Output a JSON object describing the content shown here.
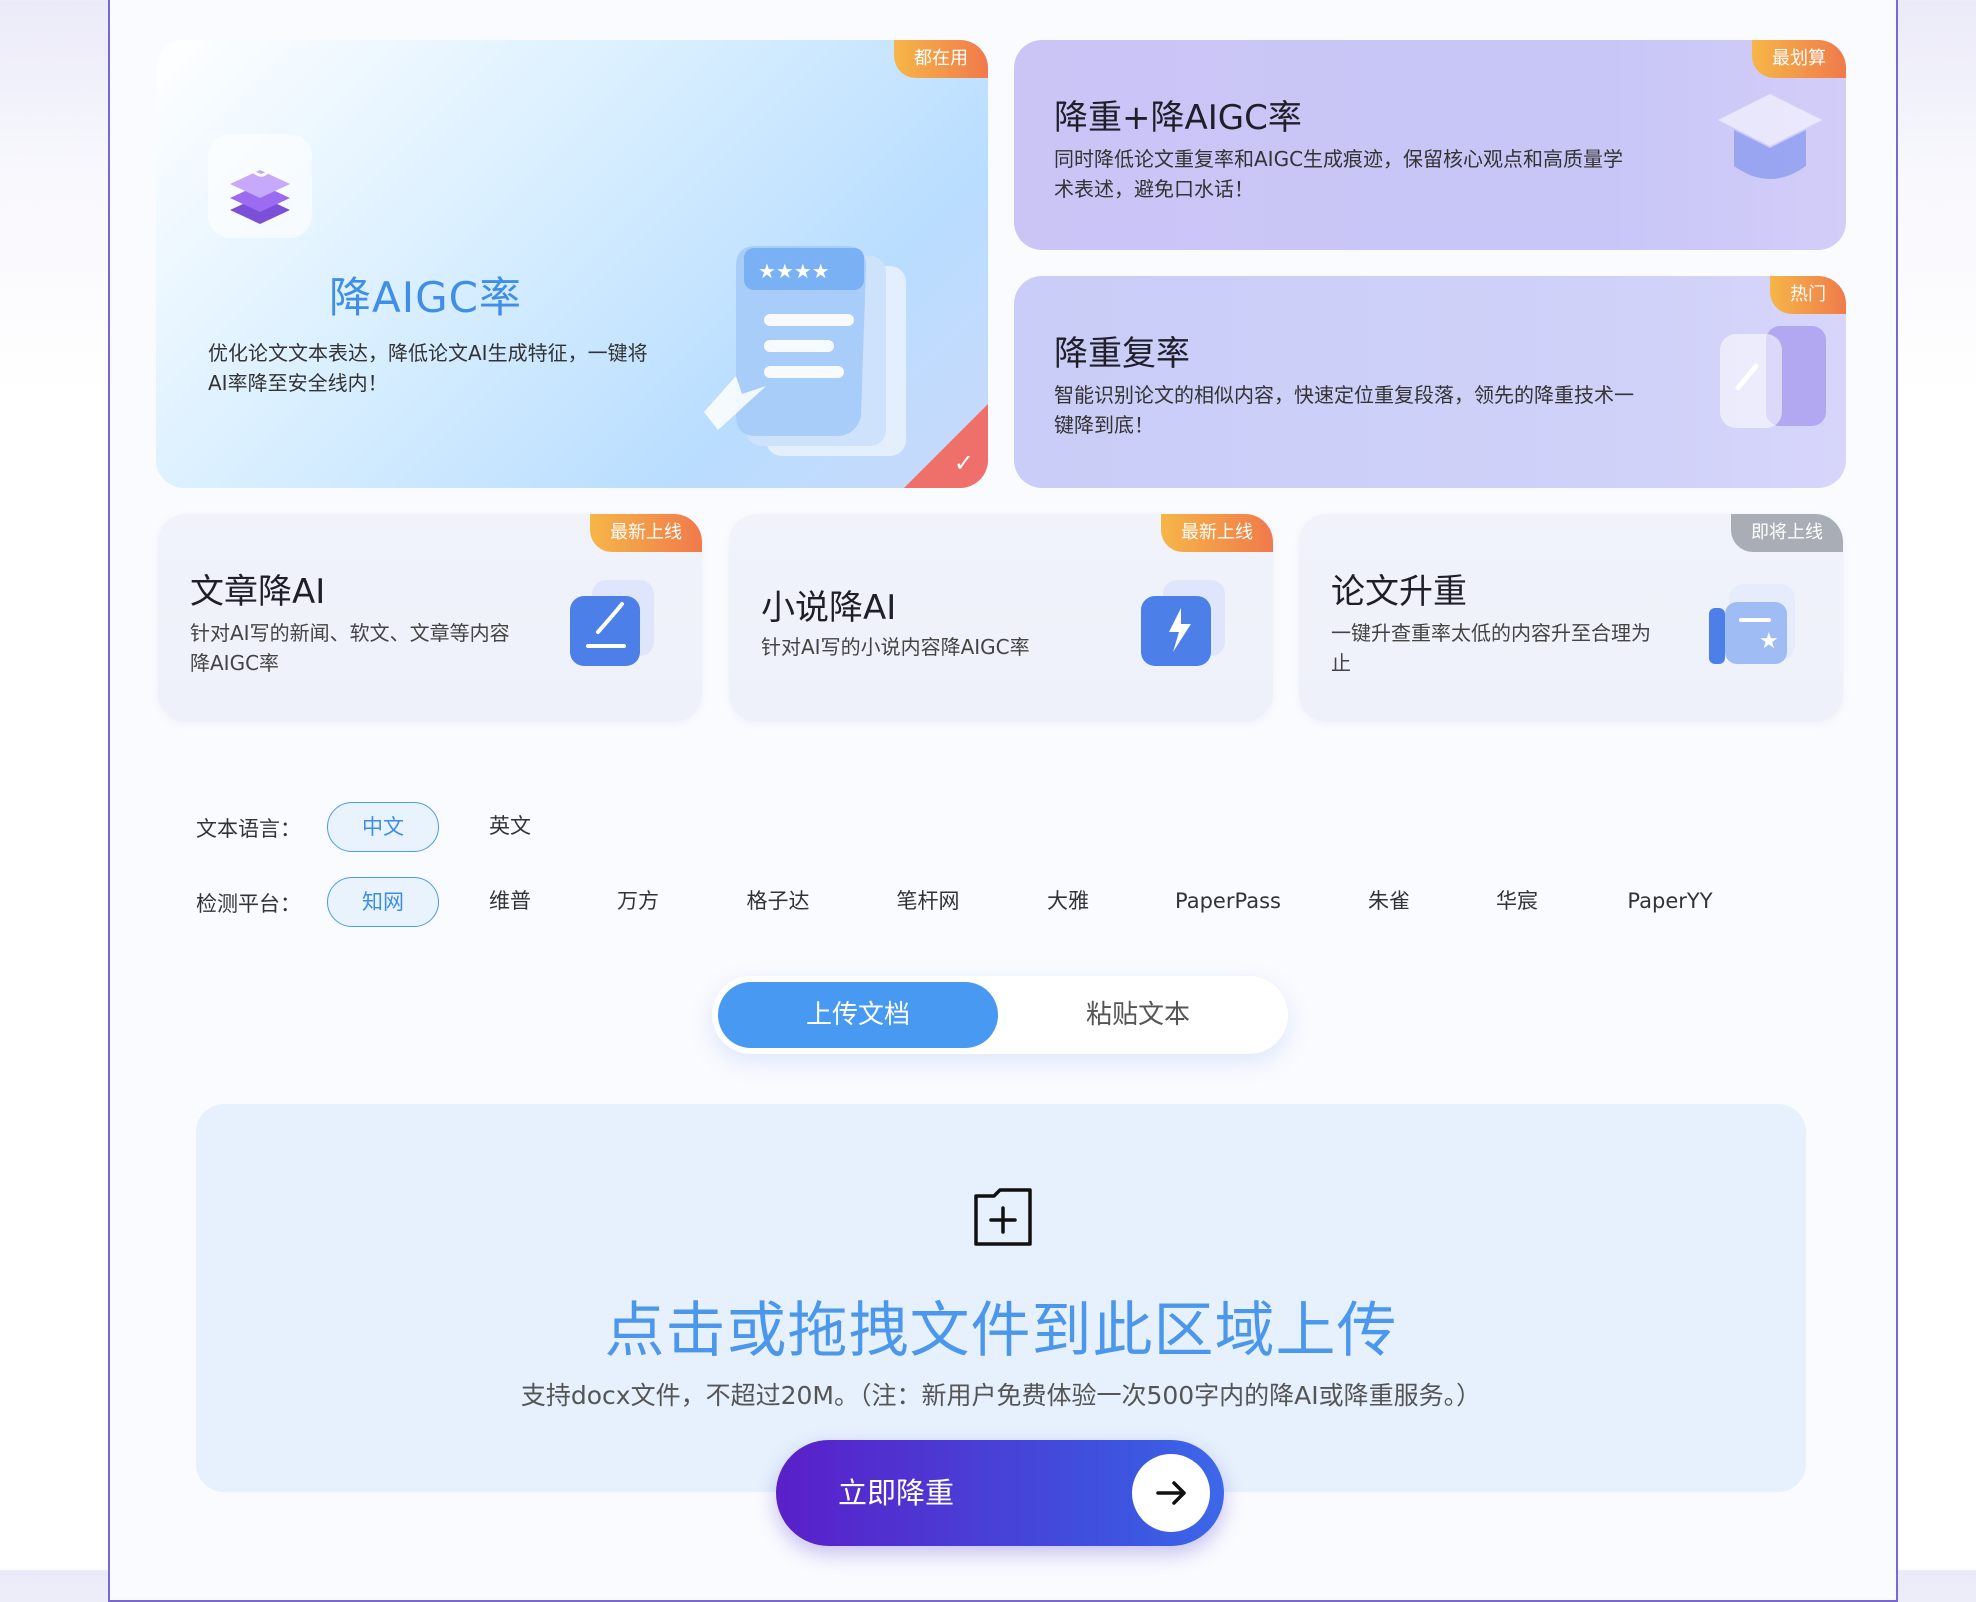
{
  "cards": {
    "main": {
      "tag": "都在用",
      "title": "降AIGC率",
      "desc": "优化论文文本表达，降低论文AI生成特征，一键将AI率降至安全线内！"
    },
    "reduce_both": {
      "tag": "最划算",
      "title": "降重+降AIGC率",
      "desc": "同时降低论文重复率和AIGC生成痕迹，保留核心观点和高质量学术表述，避免口水话！"
    },
    "reduce_dup": {
      "tag": "热门",
      "title": "降重复率",
      "desc": "智能识别论文的相似内容，快速定位重复段落，领先的降重技术一键降到底！"
    },
    "article": {
      "tag": "最新上线",
      "title": "文章降AI",
      "desc": "针对AI写的新闻、软文、文章等内容降AIGC率"
    },
    "novel": {
      "tag": "最新上线",
      "title": "小说降AI",
      "desc": "针对AI写的小说内容降AIGC率"
    },
    "increase": {
      "tag": "即将上线",
      "title": "论文升重",
      "desc": "一键升查重率太低的内容升至合理为止"
    }
  },
  "language": {
    "label": "文本语言：",
    "options": [
      "中文",
      "英文"
    ],
    "selected": "中文"
  },
  "platform": {
    "label": "检测平台：",
    "options": [
      "知网",
      "维普",
      "万方",
      "格子达",
      "笔杆网",
      "大雅",
      "PaperPass",
      "朱雀",
      "华宸",
      "PaperYY"
    ],
    "selected": "知网"
  },
  "mode": {
    "upload": "上传文档",
    "paste": "粘贴文本",
    "selected": "上传文档"
  },
  "upload": {
    "title": "点击或拖拽文件到此区域上传",
    "desc": "支持docx文件，不超过20M。（注：新用户免费体验一次500字内的降AI或降重服务。）"
  },
  "cta": {
    "label": "立即降重"
  },
  "colors": {
    "accent": "#4899f1",
    "tag_orange": "#f07a4b",
    "cta_purple": "#5a1fc9"
  }
}
